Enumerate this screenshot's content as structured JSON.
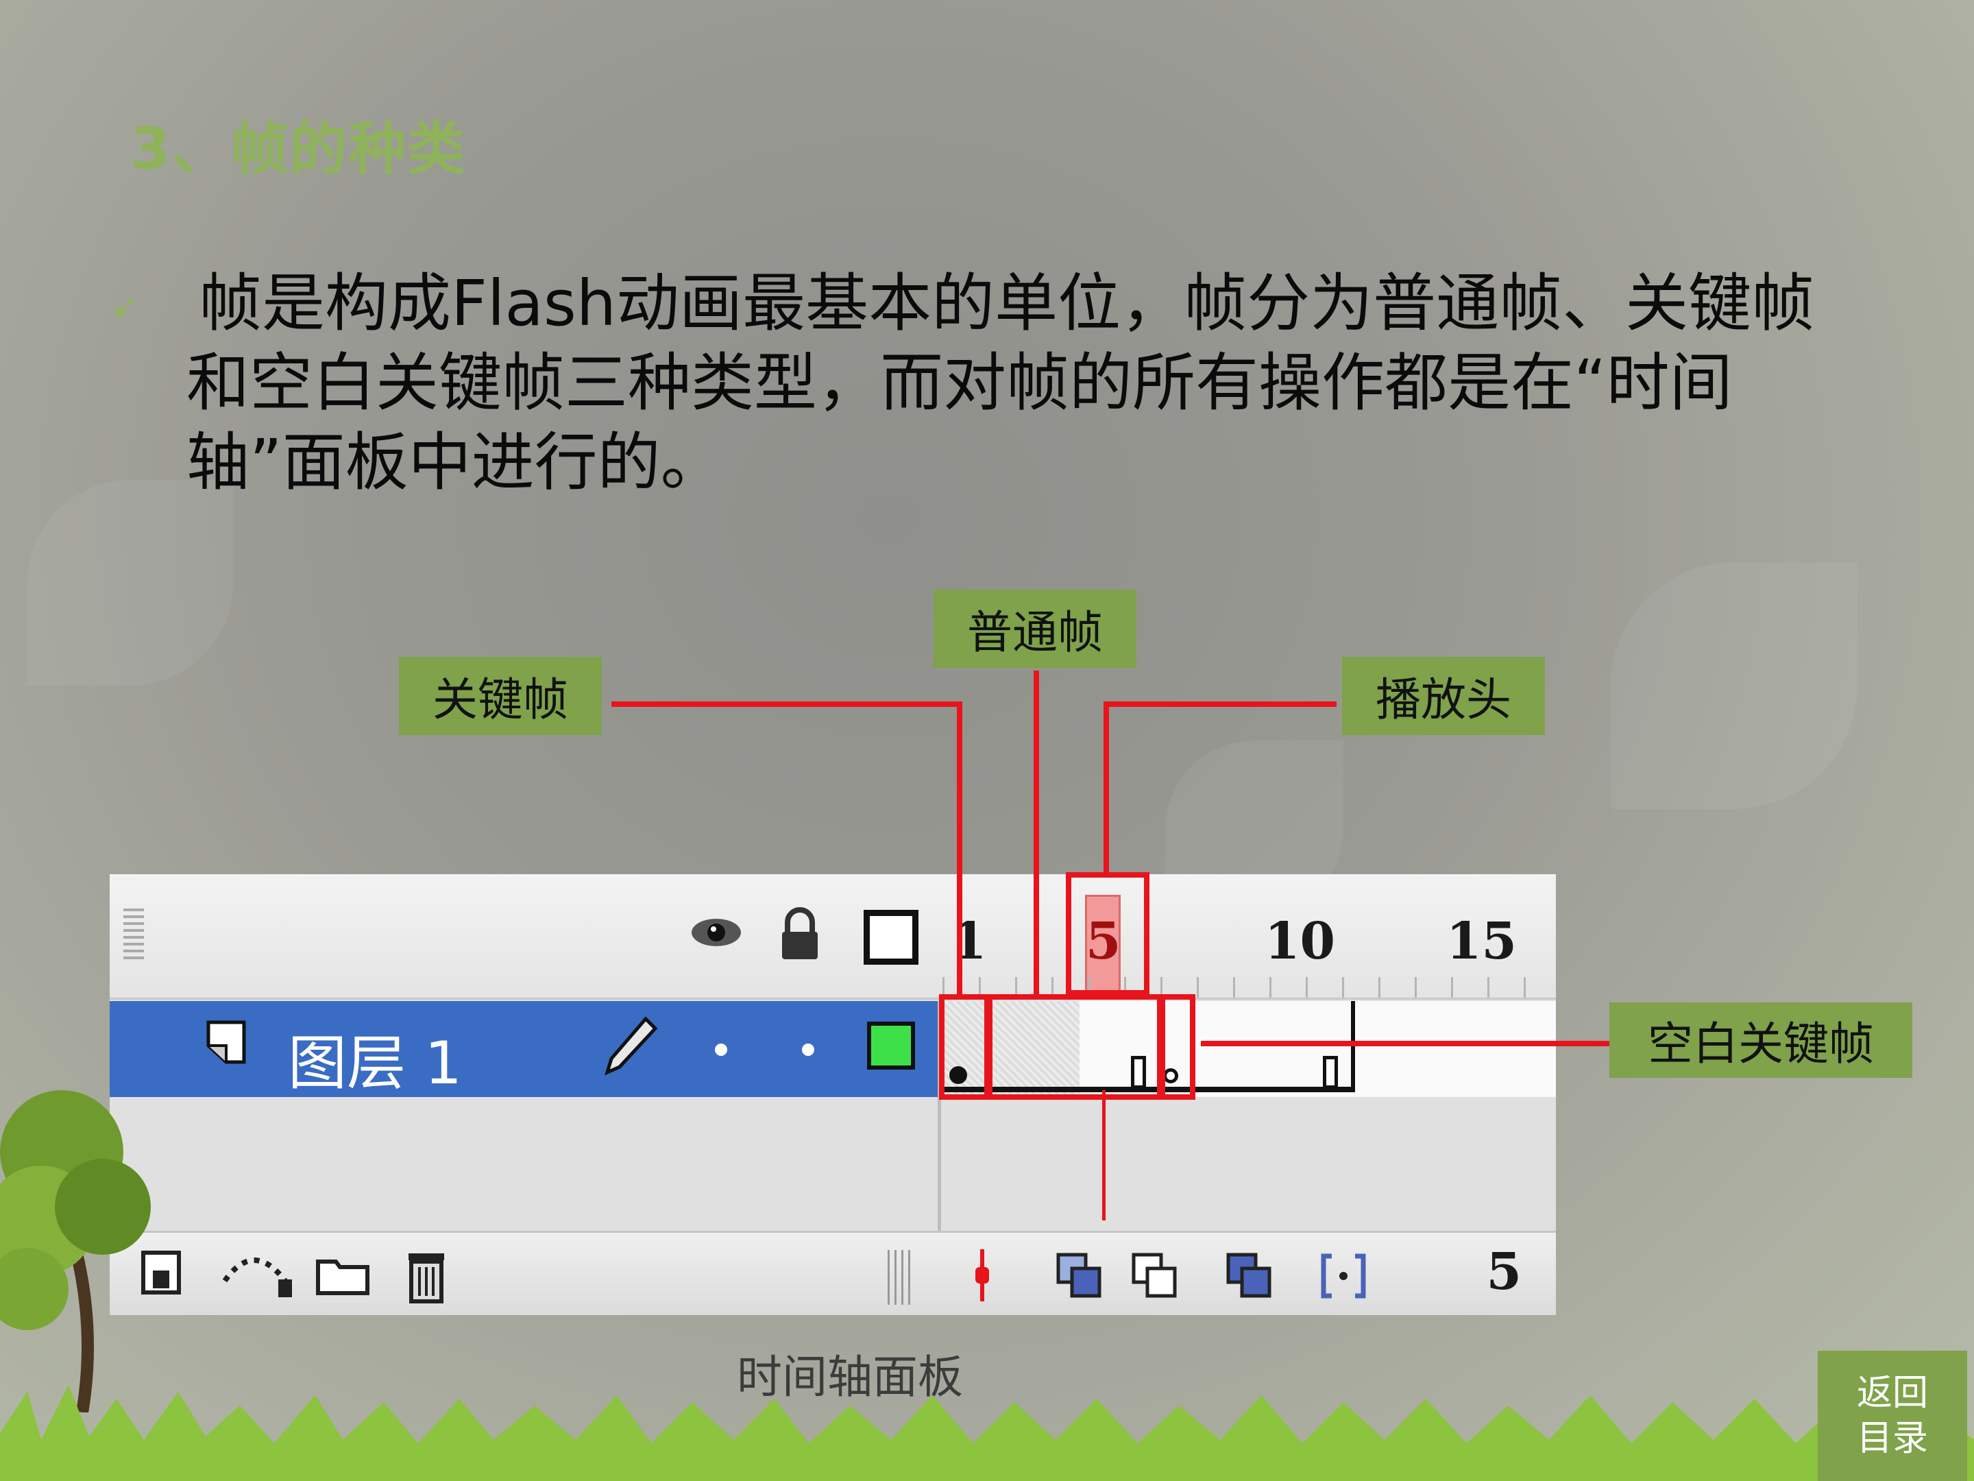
{
  "slide": {
    "title": "3、帧的种类",
    "bullet_lines": [
      "帧是构成Flash动画最基本的单位，帧分为普通帧、关键帧",
      "和空白关键帧三种类型，而对帧的所有操作都是在“时间",
      "轴”面板中进行的。"
    ]
  },
  "callouts": {
    "normal_frame": "普通帧",
    "keyframe": "关键帧",
    "playhead": "播放头",
    "blank_keyframe": "空白关键帧"
  },
  "timeline": {
    "ruler": [
      "1",
      "5",
      "10",
      "15"
    ],
    "layer_name": "图层 1",
    "frame_count": "5"
  },
  "caption": "时间轴面板",
  "nav": {
    "return_line1": "返回",
    "return_line2": "目录"
  },
  "colors": {
    "accent_green": "#7fa24a",
    "title_green": "#8fb35a",
    "highlight_red": "#e8141c",
    "layer_blue": "#3a6cc4"
  }
}
